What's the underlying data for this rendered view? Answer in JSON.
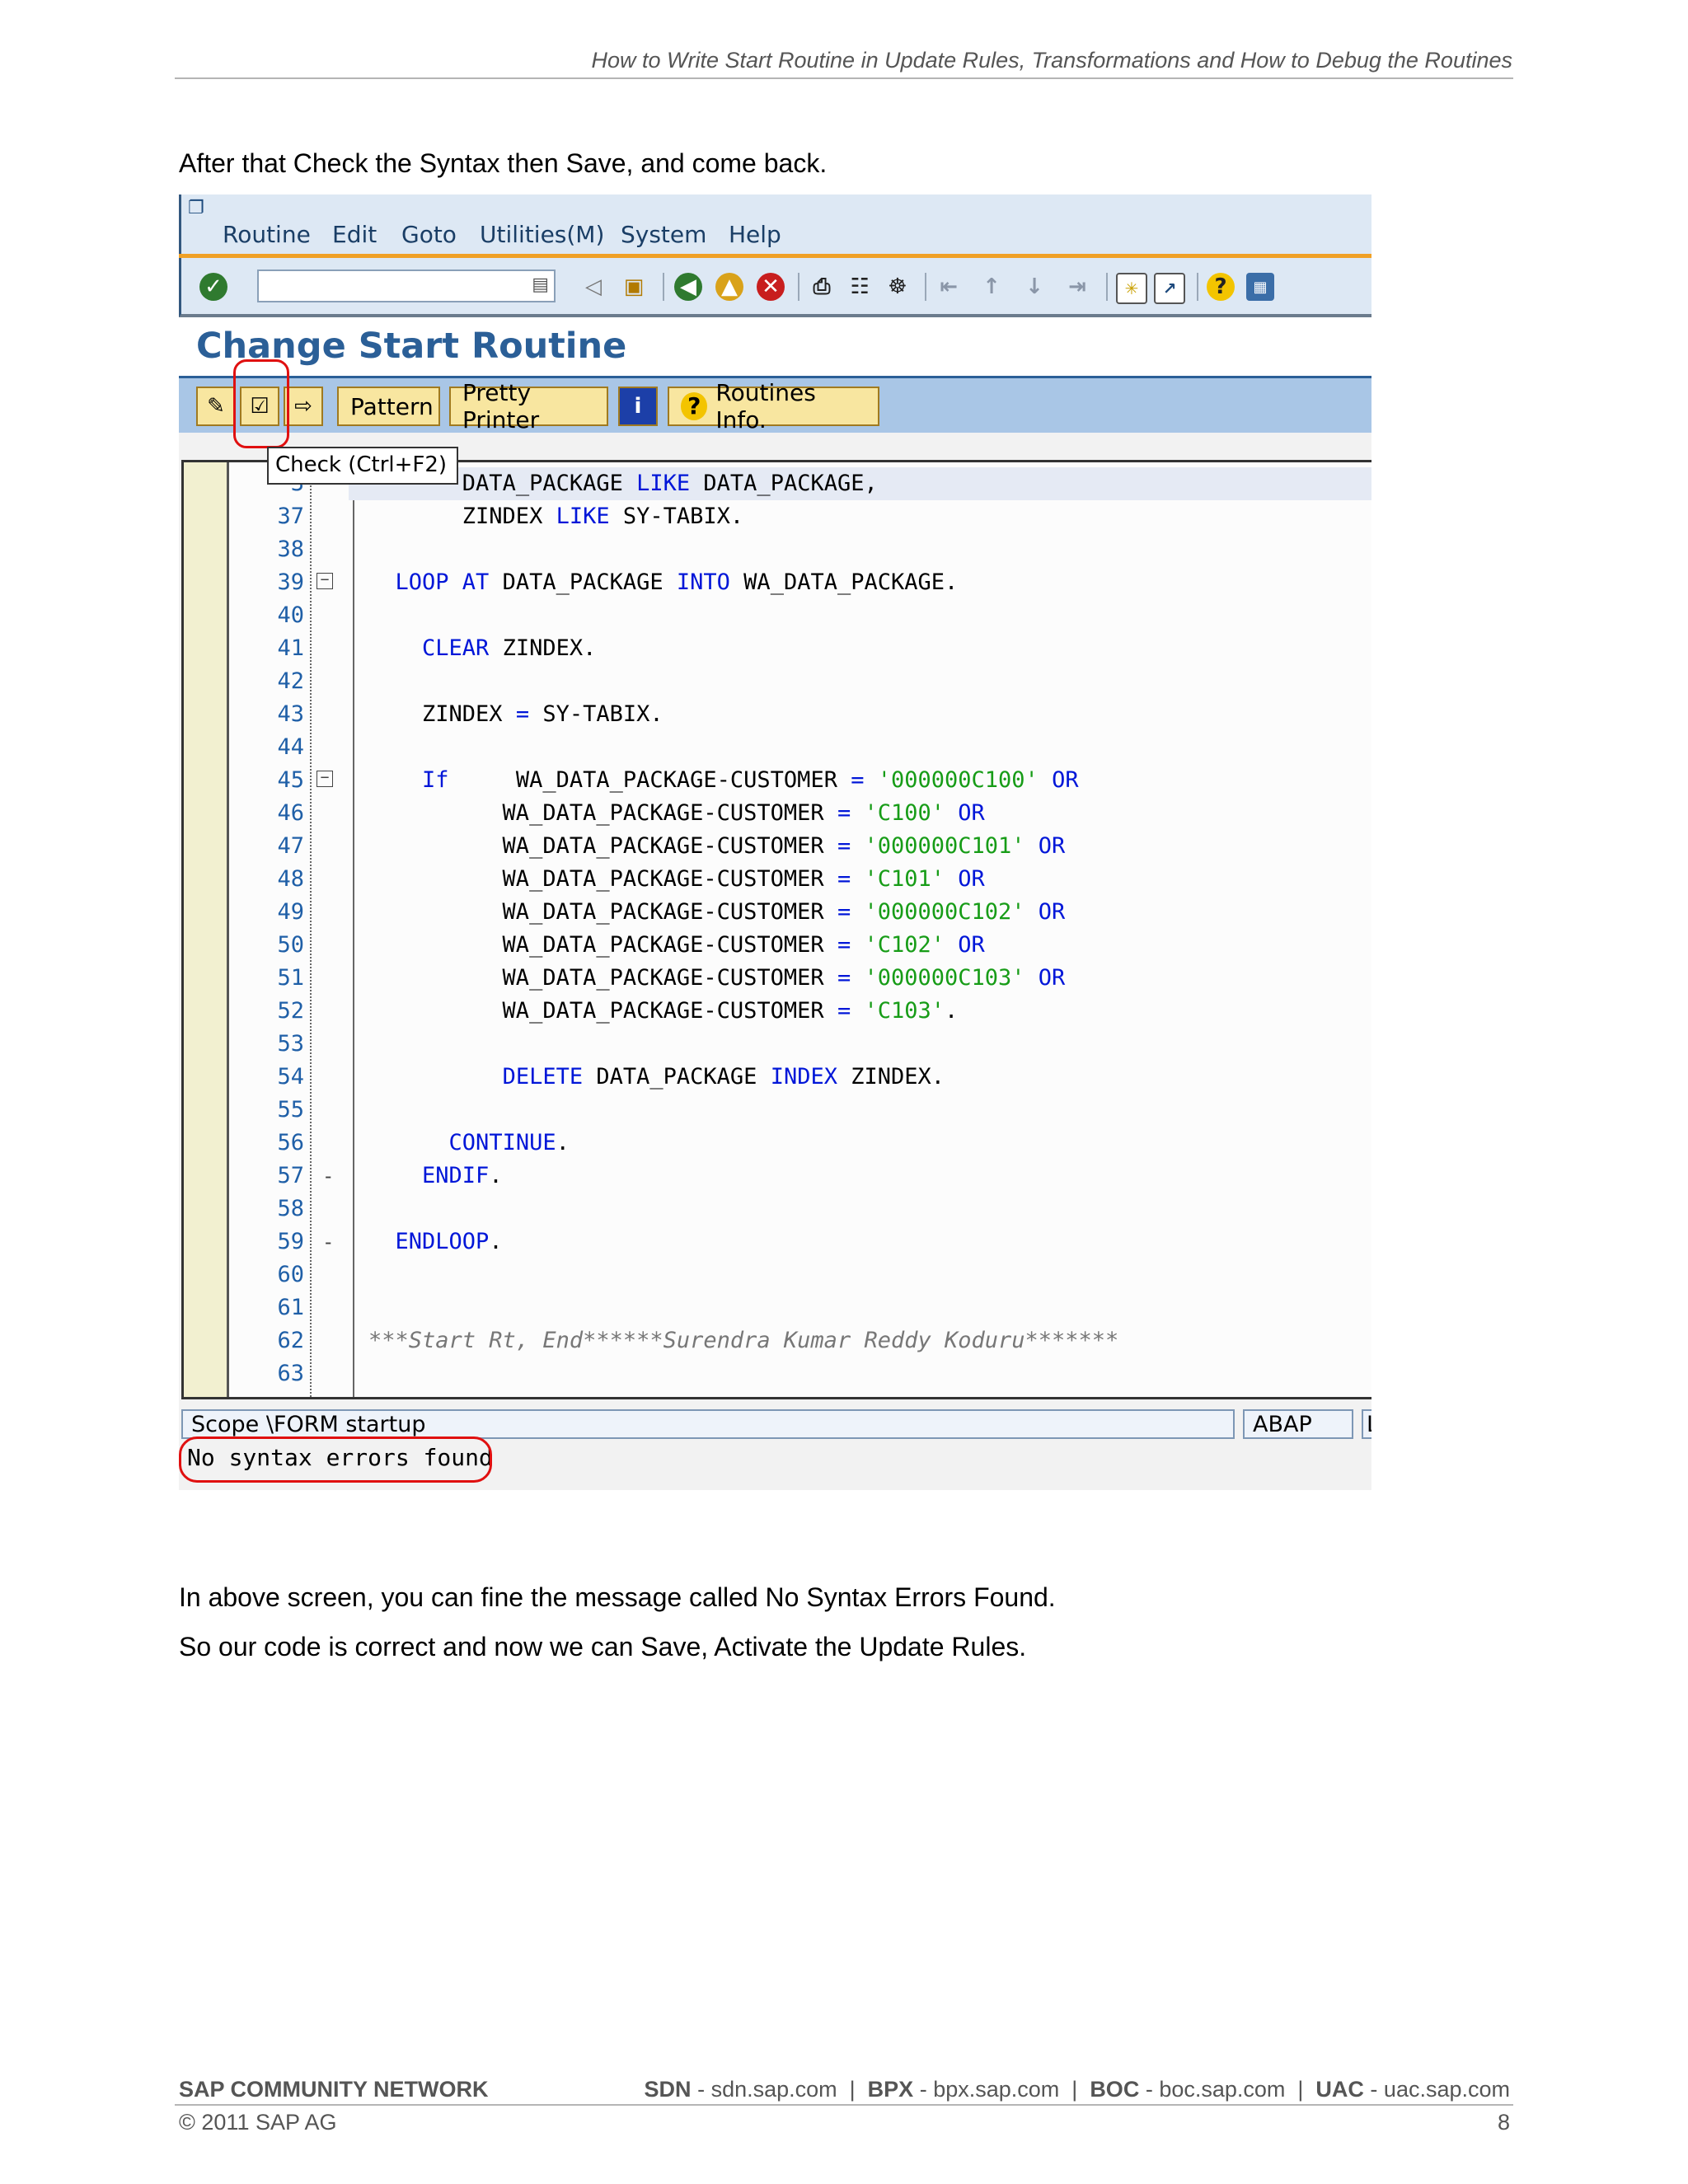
{
  "header": {
    "title": "How to Write Start Routine in Update Rules, Transformations and How to Debug the Routines"
  },
  "intro_text": "After that Check the Syntax then Save, and come back.",
  "sap": {
    "menu": [
      {
        "label": "Routine"
      },
      {
        "label": "Edit"
      },
      {
        "label": "Goto"
      },
      {
        "label": "Utilities(M)"
      },
      {
        "label": "System"
      },
      {
        "label": "Help"
      }
    ],
    "screen_title": "Change Start Routine",
    "app_buttons": {
      "pattern": "Pattern",
      "pretty_printer": "Pretty Printer",
      "routines_info": "Routines Info."
    },
    "tooltip": "Check   (Ctrl+F2)",
    "code_lines": [
      {
        "num": "3",
        "tokens": [
          [
            "id",
            "    "
          ],
          [
            "id",
            "   DATA_PACKAGE "
          ],
          [
            "kw",
            "LIKE"
          ],
          [
            "id",
            " DATA_PACKAGE"
          ],
          [
            "p",
            ","
          ]
        ]
      },
      {
        "num": "37",
        "tokens": [
          [
            "id",
            "       ZINDEX "
          ],
          [
            "kw",
            "LIKE"
          ],
          [
            "id",
            " SY-TABIX"
          ],
          [
            "p",
            "."
          ]
        ]
      },
      {
        "num": "38",
        "tokens": []
      },
      {
        "num": "39",
        "tokens": [
          [
            "id",
            "  "
          ],
          [
            "kw",
            "LOOP AT"
          ],
          [
            "id",
            " DATA_PACKAGE "
          ],
          [
            "kw",
            "INTO"
          ],
          [
            "id",
            " WA_DATA_PACKAGE"
          ],
          [
            "p",
            "."
          ]
        ]
      },
      {
        "num": "40",
        "tokens": []
      },
      {
        "num": "41",
        "tokens": [
          [
            "id",
            "    "
          ],
          [
            "kw",
            "CLEAR"
          ],
          [
            "id",
            " ZINDEX"
          ],
          [
            "p",
            "."
          ]
        ]
      },
      {
        "num": "42",
        "tokens": []
      },
      {
        "num": "43",
        "tokens": [
          [
            "id",
            "    ZINDEX "
          ],
          [
            "kw",
            "="
          ],
          [
            "id",
            " SY-TABIX"
          ],
          [
            "p",
            "."
          ]
        ]
      },
      {
        "num": "44",
        "tokens": []
      },
      {
        "num": "45",
        "tokens": [
          [
            "id",
            "    "
          ],
          [
            "kw",
            "If"
          ],
          [
            "id",
            "     WA_DATA_PACKAGE-CUSTOMER "
          ],
          [
            "kw",
            "="
          ],
          [
            "str",
            " '000000C100'"
          ],
          [
            "kw",
            " OR"
          ]
        ]
      },
      {
        "num": "46",
        "tokens": [
          [
            "id",
            "          WA_DATA_PACKAGE-CUSTOMER "
          ],
          [
            "kw",
            "="
          ],
          [
            "str",
            " 'C100'"
          ],
          [
            "kw",
            " OR"
          ]
        ]
      },
      {
        "num": "47",
        "tokens": [
          [
            "id",
            "          WA_DATA_PACKAGE-CUSTOMER "
          ],
          [
            "kw",
            "="
          ],
          [
            "str",
            " '000000C101'"
          ],
          [
            "kw",
            " OR"
          ]
        ]
      },
      {
        "num": "48",
        "tokens": [
          [
            "id",
            "          WA_DATA_PACKAGE-CUSTOMER "
          ],
          [
            "kw",
            "="
          ],
          [
            "str",
            " 'C101'"
          ],
          [
            "kw",
            " OR"
          ]
        ]
      },
      {
        "num": "49",
        "tokens": [
          [
            "id",
            "          WA_DATA_PACKAGE-CUSTOMER "
          ],
          [
            "kw",
            "="
          ],
          [
            "str",
            " '000000C102'"
          ],
          [
            "kw",
            " OR"
          ]
        ]
      },
      {
        "num": "50",
        "tokens": [
          [
            "id",
            "          WA_DATA_PACKAGE-CUSTOMER "
          ],
          [
            "kw",
            "="
          ],
          [
            "str",
            " 'C102'"
          ],
          [
            "kw",
            " OR"
          ]
        ]
      },
      {
        "num": "51",
        "tokens": [
          [
            "id",
            "          WA_DATA_PACKAGE-CUSTOMER "
          ],
          [
            "kw",
            "="
          ],
          [
            "str",
            " '000000C103'"
          ],
          [
            "kw",
            " OR"
          ]
        ]
      },
      {
        "num": "52",
        "tokens": [
          [
            "id",
            "          WA_DATA_PACKAGE-CUSTOMER "
          ],
          [
            "kw",
            "="
          ],
          [
            "str",
            " 'C103'"
          ],
          [
            "p",
            "."
          ]
        ]
      },
      {
        "num": "53",
        "tokens": []
      },
      {
        "num": "54",
        "tokens": [
          [
            "id",
            "          "
          ],
          [
            "kw",
            "DELETE"
          ],
          [
            "id",
            " DATA_PACKAGE "
          ],
          [
            "kw",
            "INDEX"
          ],
          [
            "id",
            " ZINDEX"
          ],
          [
            "p",
            "."
          ]
        ]
      },
      {
        "num": "55",
        "tokens": []
      },
      {
        "num": "56",
        "tokens": [
          [
            "id",
            "      "
          ],
          [
            "kw",
            "CONTINUE"
          ],
          [
            "p",
            "."
          ]
        ]
      },
      {
        "num": "57",
        "tokens": [
          [
            "id",
            "    "
          ],
          [
            "kw",
            "ENDIF"
          ],
          [
            "p",
            "."
          ]
        ]
      },
      {
        "num": "58",
        "tokens": []
      },
      {
        "num": "59",
        "tokens": [
          [
            "id",
            "  "
          ],
          [
            "kw",
            "ENDLOOP"
          ],
          [
            "p",
            "."
          ]
        ]
      },
      {
        "num": "60",
        "tokens": []
      },
      {
        "num": "61",
        "tokens": []
      },
      {
        "num": "62",
        "tokens": [
          [
            "cm",
            "***Start Rt, End******Surendra Kumar Reddy Koduru*******"
          ]
        ]
      },
      {
        "num": "63",
        "tokens": []
      }
    ],
    "status": {
      "scope": "Scope \\FORM startup",
      "language": "ABAP",
      "extra": "L"
    },
    "message": "No syntax errors found"
  },
  "after_text_1": "In above screen, you can fine the message called No Syntax Errors Found.",
  "after_text_2": "So our code is correct and now we can Save, Activate the Update Rules.",
  "footer": {
    "network": "SAP COMMUNITY NETWORK",
    "links": [
      {
        "label": "SDN",
        "url": "sdn.sap.com"
      },
      {
        "label": "BPX",
        "url": "bpx.sap.com"
      },
      {
        "label": "BOC",
        "url": "boc.sap.com"
      },
      {
        "label": "UAC",
        "url": "uac.sap.com"
      }
    ],
    "copyright": "© 2011 SAP AG",
    "page": "8"
  }
}
